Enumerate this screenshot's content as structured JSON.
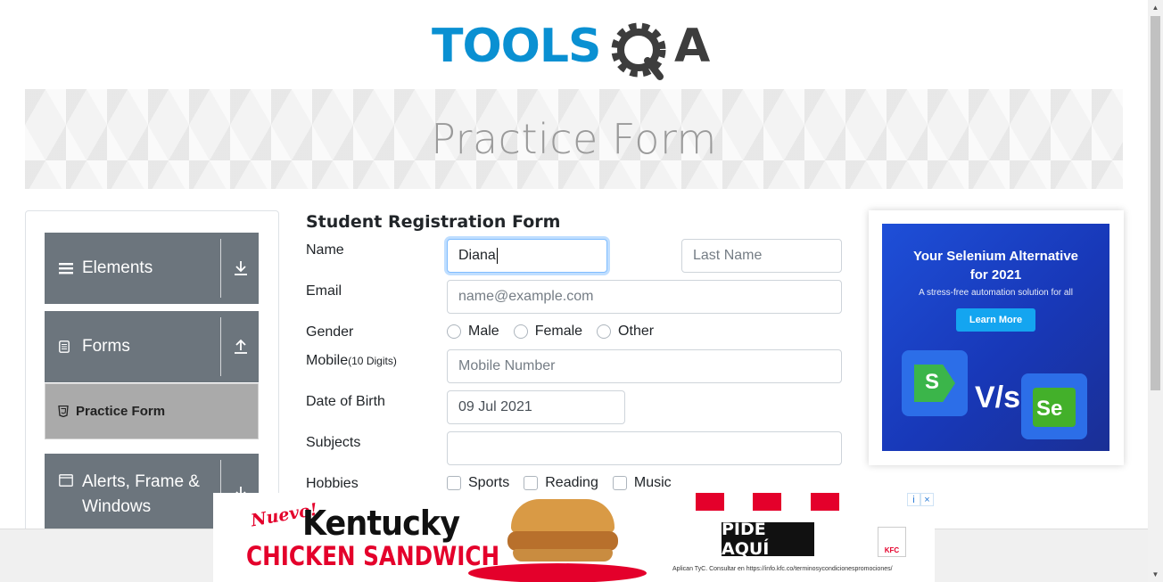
{
  "header": {
    "logo_text_left": "TOOLS",
    "logo_text_right": "A",
    "logo_colors": {
      "blue": "#0a90d2",
      "dark": "#3d3d3d"
    }
  },
  "banner": {
    "title": "Practice Form"
  },
  "sidebar": {
    "groups": [
      {
        "label": "Elements",
        "icon": "menu-icon",
        "arrow": "download-arrow-icon"
      },
      {
        "label": "Forms",
        "icon": "document-icon",
        "arrow": "upload-arrow-icon"
      },
      {
        "label": "Alerts, Frame & Windows",
        "line1": "Alerts, Frame &",
        "line2": "Windows",
        "icon": "window-icon",
        "arrow": "download-arrow-icon"
      }
    ],
    "active_item": {
      "label": "Practice Form",
      "icon": "html5-icon"
    },
    "colors": {
      "group_bg": "#6c757d",
      "active_bg": "#aaaaaa"
    }
  },
  "form": {
    "title": "Student Registration Form",
    "name_label": "Name",
    "first_name_value": "Diana",
    "last_name_placeholder": "Last Name",
    "email_label": "Email",
    "email_placeholder": "name@example.com",
    "gender_label": "Gender",
    "gender_options": [
      "Male",
      "Female",
      "Other"
    ],
    "mobile_label": "Mobile",
    "mobile_hint": "(10 Digits)",
    "mobile_placeholder": "Mobile Number",
    "dob_label": "Date of Birth",
    "dob_value": "09 Jul 2021",
    "subjects_label": "Subjects",
    "subjects_value": "",
    "hobbies_label": "Hobbies",
    "hobbies_options": [
      "Sports",
      "Reading",
      "Music"
    ]
  },
  "ad_right": {
    "headline_line1": "Your Selenium Alternative",
    "headline_line2": "for 2021",
    "subtext": "A stress-free automation solution for all",
    "button": "Learn More",
    "vs": "V/s",
    "logo_left": "S",
    "logo_right": "Se",
    "colors": {
      "bg": "#1e4fd8",
      "button": "#14a5f0"
    }
  },
  "ad_bottom": {
    "nuevo": "Nuevo!",
    "brand_line": "Kentucky",
    "product_line": "CHICKEN SANDWICH",
    "cta": "PIDE AQUÍ",
    "terms": "Aplican TyC. Consultar en https://info.kfc.co/terminosycondicionespromociones/",
    "logo": "KFC",
    "colors": {
      "red": "#e4002b"
    }
  },
  "adchoices": {
    "info": "i",
    "close": "×"
  }
}
